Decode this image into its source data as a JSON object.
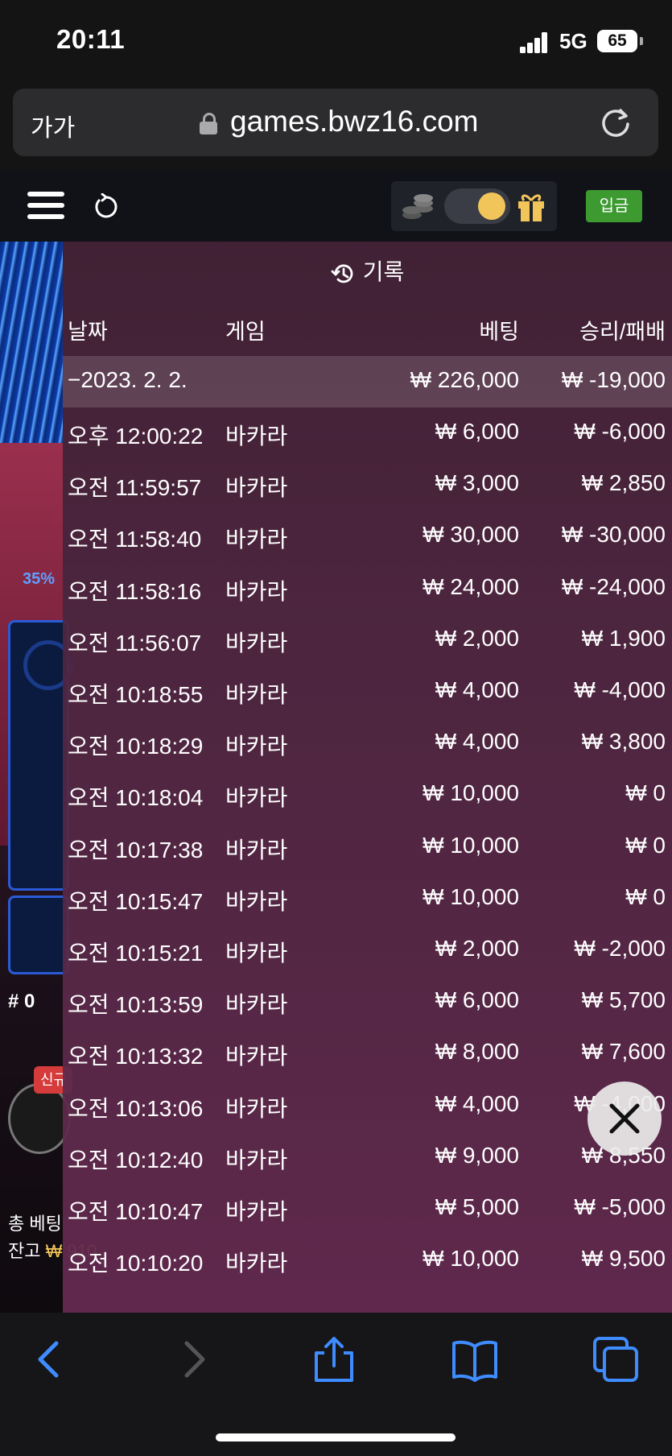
{
  "status": {
    "time": "20:11",
    "network": "5G",
    "battery": "65"
  },
  "browser": {
    "text_size_label": "가가",
    "url": "games.bwz16.com"
  },
  "header": {
    "deposit_label": "입금"
  },
  "game": {
    "percent": "35%",
    "hash_label": "# 0",
    "new_badge": "신규",
    "total_bet_label": "총 베팅",
    "balance_label": "잔고",
    "balance_value": "₩ 910"
  },
  "history": {
    "title": "기록",
    "columns": {
      "date": "날짜",
      "game": "게임",
      "bet": "베팅",
      "result": "승리/패배"
    },
    "date_group": {
      "date": "−2023. 2. 2.",
      "bet": "₩ 226,000",
      "result": "₩ -19,000"
    },
    "rows": [
      {
        "time": "오후 12:00:22",
        "game": "바카라",
        "bet": "₩ 6,000",
        "result": "₩ -6,000"
      },
      {
        "time": "오전 11:59:57",
        "game": "바카라",
        "bet": "₩ 3,000",
        "result": "₩ 2,850"
      },
      {
        "time": "오전 11:58:40",
        "game": "바카라",
        "bet": "₩ 30,000",
        "result": "₩ -30,000"
      },
      {
        "time": "오전 11:58:16",
        "game": "바카라",
        "bet": "₩ 24,000",
        "result": "₩ -24,000"
      },
      {
        "time": "오전 11:56:07",
        "game": "바카라",
        "bet": "₩ 2,000",
        "result": "₩ 1,900"
      },
      {
        "time": "오전 10:18:55",
        "game": "바카라",
        "bet": "₩ 4,000",
        "result": "₩ -4,000"
      },
      {
        "time": "오전 10:18:29",
        "game": "바카라",
        "bet": "₩ 4,000",
        "result": "₩ 3,800"
      },
      {
        "time": "오전 10:18:04",
        "game": "바카라",
        "bet": "₩ 10,000",
        "result": "₩ 0"
      },
      {
        "time": "오전 10:17:38",
        "game": "바카라",
        "bet": "₩ 10,000",
        "result": "₩ 0"
      },
      {
        "time": "오전 10:15:47",
        "game": "바카라",
        "bet": "₩ 10,000",
        "result": "₩ 0"
      },
      {
        "time": "오전 10:15:21",
        "game": "바카라",
        "bet": "₩ 2,000",
        "result": "₩ -2,000"
      },
      {
        "time": "오전 10:13:59",
        "game": "바카라",
        "bet": "₩ 6,000",
        "result": "₩ 5,700"
      },
      {
        "time": "오전 10:13:32",
        "game": "바카라",
        "bet": "₩ 8,000",
        "result": "₩ 7,600"
      },
      {
        "time": "오전 10:13:06",
        "game": "바카라",
        "bet": "₩ 4,000",
        "result": "₩ -4,000"
      },
      {
        "time": "오전 10:12:40",
        "game": "바카라",
        "bet": "₩ 9,000",
        "result": "₩ 8,550"
      },
      {
        "time": "오전 10:10:47",
        "game": "바카라",
        "bet": "₩ 5,000",
        "result": "₩ -5,000"
      },
      {
        "time": "오전 10:10:20",
        "game": "바카라",
        "bet": "₩ 10,000",
        "result": "₩ 9,500"
      }
    ]
  }
}
